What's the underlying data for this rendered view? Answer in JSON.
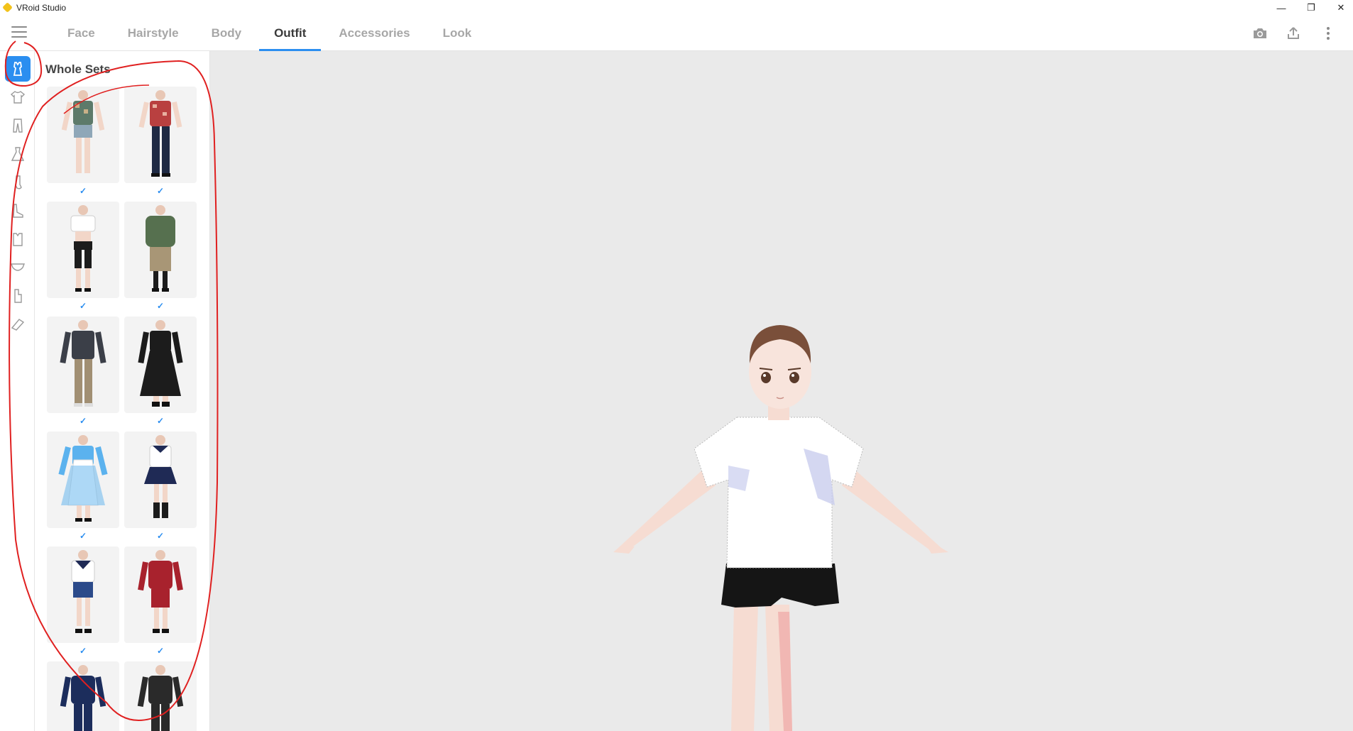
{
  "window": {
    "title": "VRoid Studio",
    "minimize_glyph": "—",
    "maximize_glyph": "❐",
    "close_glyph": "✕"
  },
  "header": {
    "tabs": [
      {
        "label": "Face",
        "active": false
      },
      {
        "label": "Hairstyle",
        "active": false
      },
      {
        "label": "Body",
        "active": false
      },
      {
        "label": "Outfit",
        "active": true
      },
      {
        "label": "Accessories",
        "active": false
      },
      {
        "label": "Look",
        "active": false
      }
    ],
    "actions": [
      "camera-icon",
      "export-icon",
      "more-vertical-icon"
    ]
  },
  "rail": {
    "items": [
      "whole-set-icon",
      "top-icon",
      "bottom-icon",
      "one-piece-icon",
      "socks-icon",
      "shoes-icon",
      "neck-accessory-icon",
      "undershirt-icon",
      "underwear-icon",
      "arm-accessory-icon"
    ],
    "active_index": 0
  },
  "panel": {
    "title": "Whole Sets",
    "items": [
      {
        "name": "casual-print-shirt-shorts",
        "checked": false
      },
      {
        "name": "red-print-shirt-jeans",
        "checked": false
      },
      {
        "name": "white-crop-top-shorts",
        "checked": true
      },
      {
        "name": "green-hoodie-leopard-skirt",
        "checked": true
      },
      {
        "name": "dark-shirt-khaki-pants",
        "checked": true
      },
      {
        "name": "black-long-dress",
        "checked": true
      },
      {
        "name": "blue-maid-dress",
        "checked": true
      },
      {
        "name": "sailor-uniform-skirt",
        "checked": true
      },
      {
        "name": "sailor-uniform-shorts",
        "checked": true
      },
      {
        "name": "red-jacket-shorts",
        "checked": true
      },
      {
        "name": "navy-tracksuit",
        "checked": true
      },
      {
        "name": "black-tracksuit",
        "checked": true
      }
    ],
    "check_glyph": "✓"
  },
  "colors": {
    "accent": "#2b8ef0",
    "viewport_bg": "#eaeaea",
    "annotation": "#e02020"
  }
}
